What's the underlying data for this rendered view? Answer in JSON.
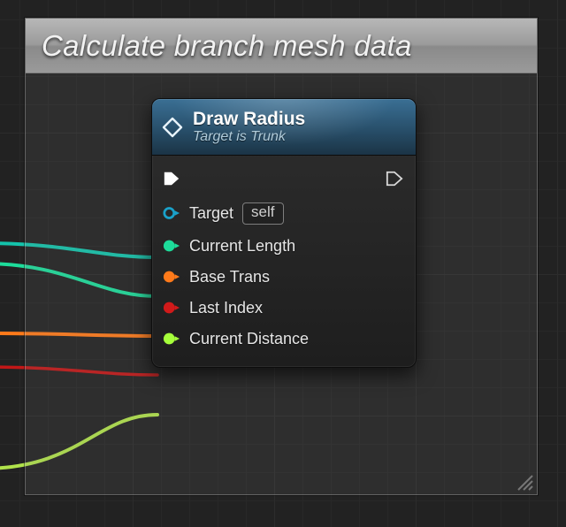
{
  "comment": {
    "title": "Calculate branch mesh data"
  },
  "node": {
    "title": "Draw Radius",
    "subtitle": "Target is Trunk",
    "pins": {
      "target": {
        "label": "Target",
        "default": "self",
        "color": "#1aa1c9"
      },
      "currentLength": {
        "label": "Current Length",
        "color": "#1ddc9a"
      },
      "baseTrans": {
        "label": "Base Trans",
        "color": "#ff7a1a"
      },
      "lastIndex": {
        "label": "Last Index",
        "color": "#d11a1a"
      },
      "currentDistance": {
        "label": "Current Distance",
        "color": "#a6ff3b"
      }
    }
  },
  "colors": {
    "wire_teal": "#14c3ab",
    "wire_green": "#1ddc9a",
    "wire_orange": "#ff7a1a",
    "wire_red": "#c21717",
    "wire_lime": "#b0e24b"
  }
}
